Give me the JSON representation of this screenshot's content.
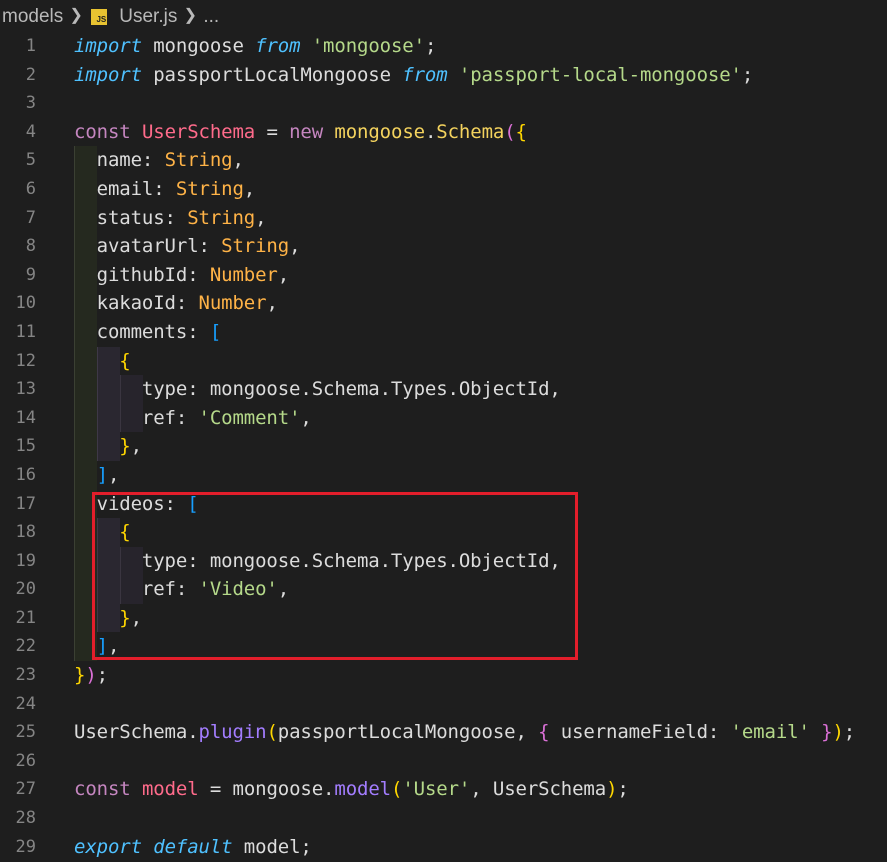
{
  "breadcrumb": {
    "folder": "models",
    "file": "User.js",
    "more": "...",
    "file_icon": "js-file-icon",
    "js_badge": "JS"
  },
  "editor": {
    "line_numbers": [
      "1",
      "2",
      "3",
      "4",
      "5",
      "6",
      "7",
      "8",
      "9",
      "10",
      "11",
      "12",
      "13",
      "14",
      "15",
      "16",
      "17",
      "18",
      "19",
      "20",
      "21",
      "22",
      "23",
      "24",
      "25",
      "26",
      "27",
      "28",
      "29"
    ],
    "lines": [
      [
        [
          "kw-i",
          "import"
        ],
        [
          "var",
          " mongoose "
        ],
        [
          "kw-i",
          "from"
        ],
        [
          "var",
          " "
        ],
        [
          "str",
          "'mongoose'"
        ],
        [
          "var",
          ";"
        ]
      ],
      [
        [
          "kw-i",
          "import"
        ],
        [
          "var",
          " passportLocalMongoose "
        ],
        [
          "kw-i",
          "from"
        ],
        [
          "var",
          " "
        ],
        [
          "str",
          "'passport-local-mongoose'"
        ],
        [
          "var",
          ";"
        ]
      ],
      [],
      [
        [
          "kw",
          "const"
        ],
        [
          "var",
          " "
        ],
        [
          "red-var",
          "UserSchema"
        ],
        [
          "var",
          " = "
        ],
        [
          "kw",
          "new"
        ],
        [
          "var",
          " "
        ],
        [
          "cls",
          "mongoose"
        ],
        [
          "var",
          "."
        ],
        [
          "cls",
          "Schema"
        ],
        [
          "br2",
          "("
        ],
        [
          "br1",
          "{"
        ]
      ],
      [
        [
          "var",
          "  name: "
        ],
        [
          "type",
          "String"
        ],
        [
          "var",
          ","
        ]
      ],
      [
        [
          "var",
          "  email: "
        ],
        [
          "type",
          "String"
        ],
        [
          "var",
          ","
        ]
      ],
      [
        [
          "var",
          "  status: "
        ],
        [
          "type",
          "String"
        ],
        [
          "var",
          ","
        ]
      ],
      [
        [
          "var",
          "  avatarUrl: "
        ],
        [
          "type",
          "String"
        ],
        [
          "var",
          ","
        ]
      ],
      [
        [
          "var",
          "  githubId: "
        ],
        [
          "type",
          "Number"
        ],
        [
          "var",
          ","
        ]
      ],
      [
        [
          "var",
          "  kakaoId: "
        ],
        [
          "type",
          "Number"
        ],
        [
          "var",
          ","
        ]
      ],
      [
        [
          "var",
          "  comments: "
        ],
        [
          "br3",
          "["
        ]
      ],
      [
        [
          "var",
          "    "
        ],
        [
          "br1",
          "{"
        ]
      ],
      [
        [
          "var",
          "      type: mongoose.Schema.Types.ObjectId,"
        ]
      ],
      [
        [
          "var",
          "      ref: "
        ],
        [
          "str",
          "'Comment'"
        ],
        [
          "var",
          ","
        ]
      ],
      [
        [
          "var",
          "    "
        ],
        [
          "br1",
          "}"
        ],
        [
          "var",
          ","
        ]
      ],
      [
        [
          "var",
          "  "
        ],
        [
          "br3",
          "]"
        ],
        [
          "var",
          ","
        ]
      ],
      [
        [
          "var",
          "  videos: "
        ],
        [
          "br3",
          "["
        ]
      ],
      [
        [
          "var",
          "    "
        ],
        [
          "br1",
          "{"
        ]
      ],
      [
        [
          "var",
          "      type: mongoose.Schema.Types.ObjectId,"
        ]
      ],
      [
        [
          "var",
          "      ref: "
        ],
        [
          "str",
          "'Video'"
        ],
        [
          "var",
          ","
        ]
      ],
      [
        [
          "var",
          "    "
        ],
        [
          "br1",
          "}"
        ],
        [
          "var",
          ","
        ]
      ],
      [
        [
          "var",
          "  "
        ],
        [
          "br3",
          "]"
        ],
        [
          "var",
          ","
        ]
      ],
      [
        [
          "br1",
          "}"
        ],
        [
          "br2",
          ")"
        ],
        [
          "var",
          ";"
        ]
      ],
      [],
      [
        [
          "var",
          "UserSchema."
        ],
        [
          "fn",
          "plugin"
        ],
        [
          "br1",
          "("
        ],
        [
          "var",
          "passportLocalMongoose, "
        ],
        [
          "br2",
          "{"
        ],
        [
          "var",
          " usernameField: "
        ],
        [
          "str",
          "'email'"
        ],
        [
          "var",
          " "
        ],
        [
          "br2",
          "}"
        ],
        [
          "br1",
          ")"
        ],
        [
          "var",
          ";"
        ]
      ],
      [],
      [
        [
          "kw",
          "const"
        ],
        [
          "var",
          " "
        ],
        [
          "red-var",
          "model"
        ],
        [
          "var",
          " = mongoose."
        ],
        [
          "fn",
          "model"
        ],
        [
          "br1",
          "("
        ],
        [
          "str",
          "'User'"
        ],
        [
          "var",
          ", UserSchema"
        ],
        [
          "br1",
          ")"
        ],
        [
          "var",
          ";"
        ]
      ],
      [],
      [
        [
          "kw-i",
          "export"
        ],
        [
          "var",
          " "
        ],
        [
          "kw-i",
          "default"
        ],
        [
          "var",
          " model;"
        ]
      ]
    ],
    "guides": [
      [],
      [],
      [],
      [],
      [
        "g1"
      ],
      [
        "g1"
      ],
      [
        "g1"
      ],
      [
        "g1"
      ],
      [
        "g1"
      ],
      [
        "g1"
      ],
      [
        "g1"
      ],
      [
        "g1",
        "g2"
      ],
      [
        "g1",
        "g2",
        "g3"
      ],
      [
        "g1",
        "g2",
        "g3"
      ],
      [
        "g1",
        "g2"
      ],
      [
        "g1"
      ],
      [
        "g1"
      ],
      [
        "g1",
        "g2"
      ],
      [
        "g1",
        "g2",
        "g3"
      ],
      [
        "g1",
        "g2",
        "g3"
      ],
      [
        "g1",
        "g2"
      ],
      [
        "g1"
      ],
      [],
      [],
      [],
      [],
      [],
      [],
      []
    ]
  },
  "colors": {
    "background": "#1e1e1e",
    "line_number": "#858585",
    "highlight_border": "#e31e2b"
  }
}
